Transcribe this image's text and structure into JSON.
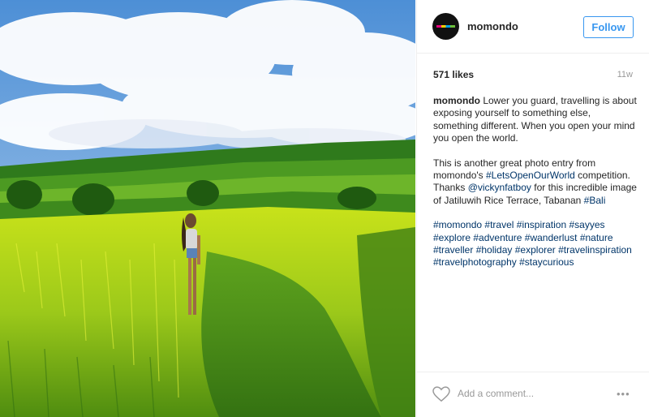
{
  "post": {
    "username": "momondo",
    "follow_label": "Follow",
    "likes": "571 likes",
    "time_ago": "11w"
  },
  "caption": {
    "username": "momondo",
    "p1_text": " Lower you guard, travelling is about exposing yourself to something else, something different. When you open your mind you open the world.",
    "p2_a": "This is another great photo entry from momondo's ",
    "p2_tag1": "#LetsOpenOurWorld",
    "p2_b": " competition. Thanks ",
    "p2_mention": "@vickynfatboy",
    "p2_c": " for this incredible image of Jatiluwih Rice Terrace, Tabanan ",
    "p2_tag2": "#Bali",
    "hashtags": [
      "#momondo",
      "#travel",
      "#inspiration",
      "#sayyes",
      "#explore",
      "#adventure",
      "#wanderlust",
      "#nature",
      "#traveller",
      "#holiday",
      "#explorer",
      "#travelinspiration",
      "#travelphotography",
      "#staycurious"
    ]
  },
  "footer": {
    "comment_placeholder": "Add a comment...",
    "more_label": "•••"
  },
  "icons": {
    "heart": "heart-icon",
    "more": "more-options-icon"
  },
  "colors": {
    "accent": "#3897f0",
    "hashtag": "#003569",
    "muted": "#999999"
  }
}
